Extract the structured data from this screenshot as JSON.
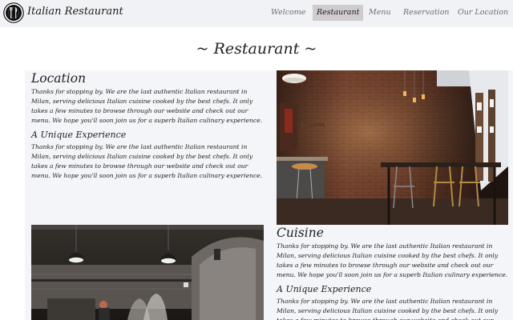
{
  "brand": {
    "name": "Italian Restaurant"
  },
  "nav": {
    "items": [
      {
        "label": "Welcome",
        "active": false
      },
      {
        "label": "Restaurant",
        "active": true
      },
      {
        "label": "Menu",
        "active": false
      },
      {
        "label": "Reservation",
        "active": false
      },
      {
        "label": "Our Location",
        "active": false
      }
    ]
  },
  "page": {
    "heading": "~ Restaurant ~"
  },
  "sections": {
    "location": {
      "title": "Location",
      "text": "Thanks for stopping by. We are the last authentic Italian restaurant in Milan, serving delicious Italian cuisine cooked by the best chefs. It only takes a few minutes to browse through our website and check out our menu. We hope you'll soon join us for a superb Italian culinary experience.",
      "subtitle": "A Unique Experience",
      "subtext": "Thanks for stopping by. We are the last authentic Italian restaurant in Milan, serving delicious Italian cuisine cooked by the best chefs. It only takes a few minutes to browse through our website and check out our menu. We hope you'll soon join us for a superb Italian culinary experience."
    },
    "cuisine": {
      "title": "Cuisine",
      "text": "Thanks for stopping by. We are the last authentic Italian restaurant in Milan, serving delicious Italian cuisine cooked by the best chefs. It only takes a few minutes to browse through our website and check out our menu. We hope you'll soon join us for a superb Italian culinary experience.",
      "subtitle": "A Unique Experience",
      "subtext": "Thanks for stopping by. We are the last authentic Italian restaurant in Milan, serving delicious Italian cuisine cooked by the best chefs. It only takes a few minutes to browse through our website and check out our menu. We hope you'll soon join us for a superb Italian culinary experience."
    }
  },
  "colors": {
    "navbar_bg": "#f1f2f5",
    "active_tab_bg": "#cfcbcf",
    "content_bg": "#f4f5f8",
    "text": "#222222"
  },
  "icons": {
    "logo": "fork-knife-plate-icon"
  }
}
